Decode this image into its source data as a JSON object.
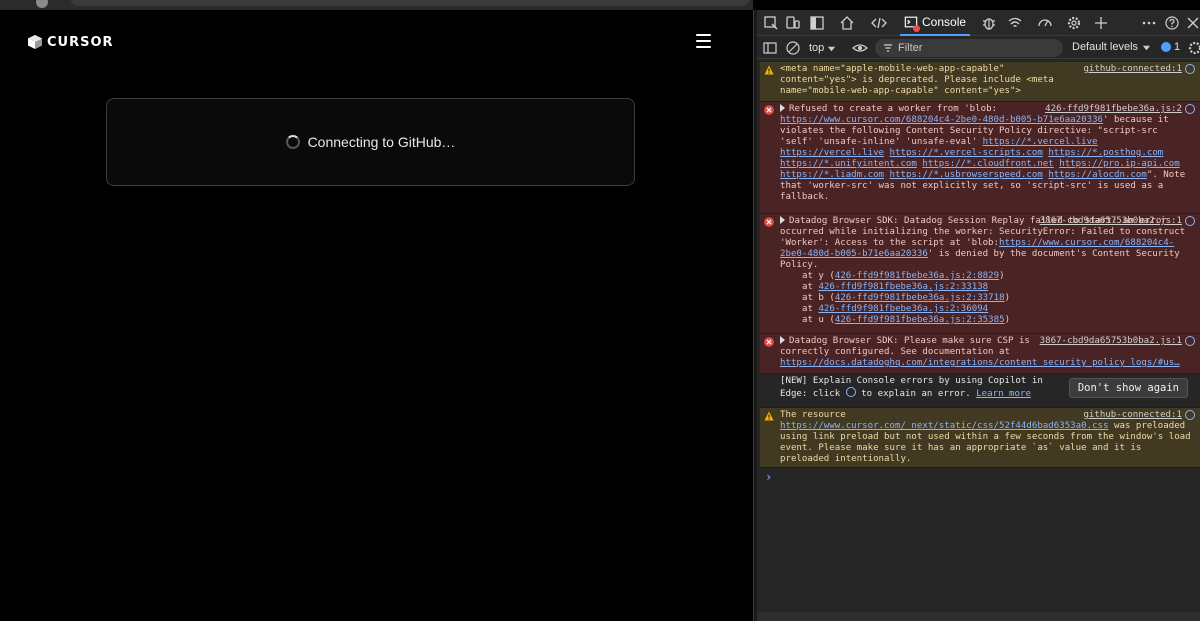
{
  "page": {
    "logo_text": "CURSOR",
    "status_text": "Connecting to GitHub…"
  },
  "devtools": {
    "tabs": {
      "console_label": "Console"
    },
    "toolbar": {
      "context": "top",
      "filter_placeholder": "Filter",
      "levels": "Default levels",
      "issues_count": "1"
    },
    "messages": {
      "m1": {
        "text": "<meta name=\"apple-mobile-web-app-capable\" content=\"yes\"> is deprecated. Please include <meta name=\"mobile-web-app-capable\" content=\"yes\">",
        "source": "github-connected:1"
      },
      "m2": {
        "source": "426-ffd9f981fbebe36a.js:2",
        "t1": "Refused to create a worker from 'blob:",
        "l1": "https://www.cursor.com/688204c4-2be0-480d-b005-b71e6aa20336",
        "t2": "' because it violates the following Content Security Policy directive: \"script-src 'self' 'unsafe-inline' 'unsafe-eval' ",
        "l2": "https://*.vercel.live",
        "l3": "https://vercel.live",
        "l4": "https://*.vercel-scripts.com",
        "l5": "https://*.posthog.com",
        "l6": "https://*.unifyintent.com",
        "l7": "https://*.cloudfront.net",
        "l8": "https://pro.ip-api.com",
        "l9": "https://*.liadm.com",
        "l10": "https://*.usbrowserspeed.com",
        "l11": "https://alocdn.com",
        "t3": "\". Note that 'worker-src' was not explicitly set, so 'script-src' is used as a fallback."
      },
      "m3": {
        "source": "3867-cbd9da65753b0ba2.js:1",
        "t1": "Datadog Browser SDK: Datadog Session Replay failed to start: an error occurred while initializing the worker: SecurityError: Failed to construct 'Worker': Access to the script at 'blob:",
        "l1": "https://www.cursor.com/688204c4-2be0-480d-b005-b71e6aa20336",
        "t2": "' is denied by the document's Content Security Policy.",
        "stack": [
          {
            "pre": "at y (",
            "link": "426-ffd9f981fbebe36a.js:2:8829",
            "post": ")"
          },
          {
            "pre": "at ",
            "link": "426-ffd9f981fbebe36a.js:2:33138",
            "post": ""
          },
          {
            "pre": "at b (",
            "link": "426-ffd9f981fbebe36a.js:2:33718",
            "post": ")"
          },
          {
            "pre": "at ",
            "link": "426-ffd9f981fbebe36a.js:2:36094",
            "post": ""
          },
          {
            "pre": "at u (",
            "link": "426-ffd9f981fbebe36a.js:2:35385",
            "post": ")"
          }
        ]
      },
      "m4": {
        "source": "3867-cbd9da65753b0ba2.js:1",
        "t1": "Datadog Browser SDK: Please make sure CSP is correctly configured. See documentation at",
        "l1": "https://docs.datadoghq.com/integrations/content_security_policy_logs/#us…"
      },
      "copilot": {
        "t1": "[NEW] Explain Console errors by using Copilot in Edge: click",
        "t2": "to explain an error.",
        "learn": "Learn more",
        "dont_show": "Don't show again"
      },
      "m5": {
        "source": "github-connected:1",
        "t1": "The resource",
        "l1": "https://www.cursor.com/_next/static/css/52f44d6bad6353a0.css",
        "t2": " was preloaded using link preload but not used within a few seconds from the window's load event. Please make sure it has an appropriate `as` value and it is preloaded intentionally."
      }
    },
    "prompt_symbol": "›"
  },
  "colors": {
    "accent": "#4ea0ff",
    "warning_bg": "#413922",
    "error_bg": "#4a2424",
    "link": "#8ab4f8"
  }
}
